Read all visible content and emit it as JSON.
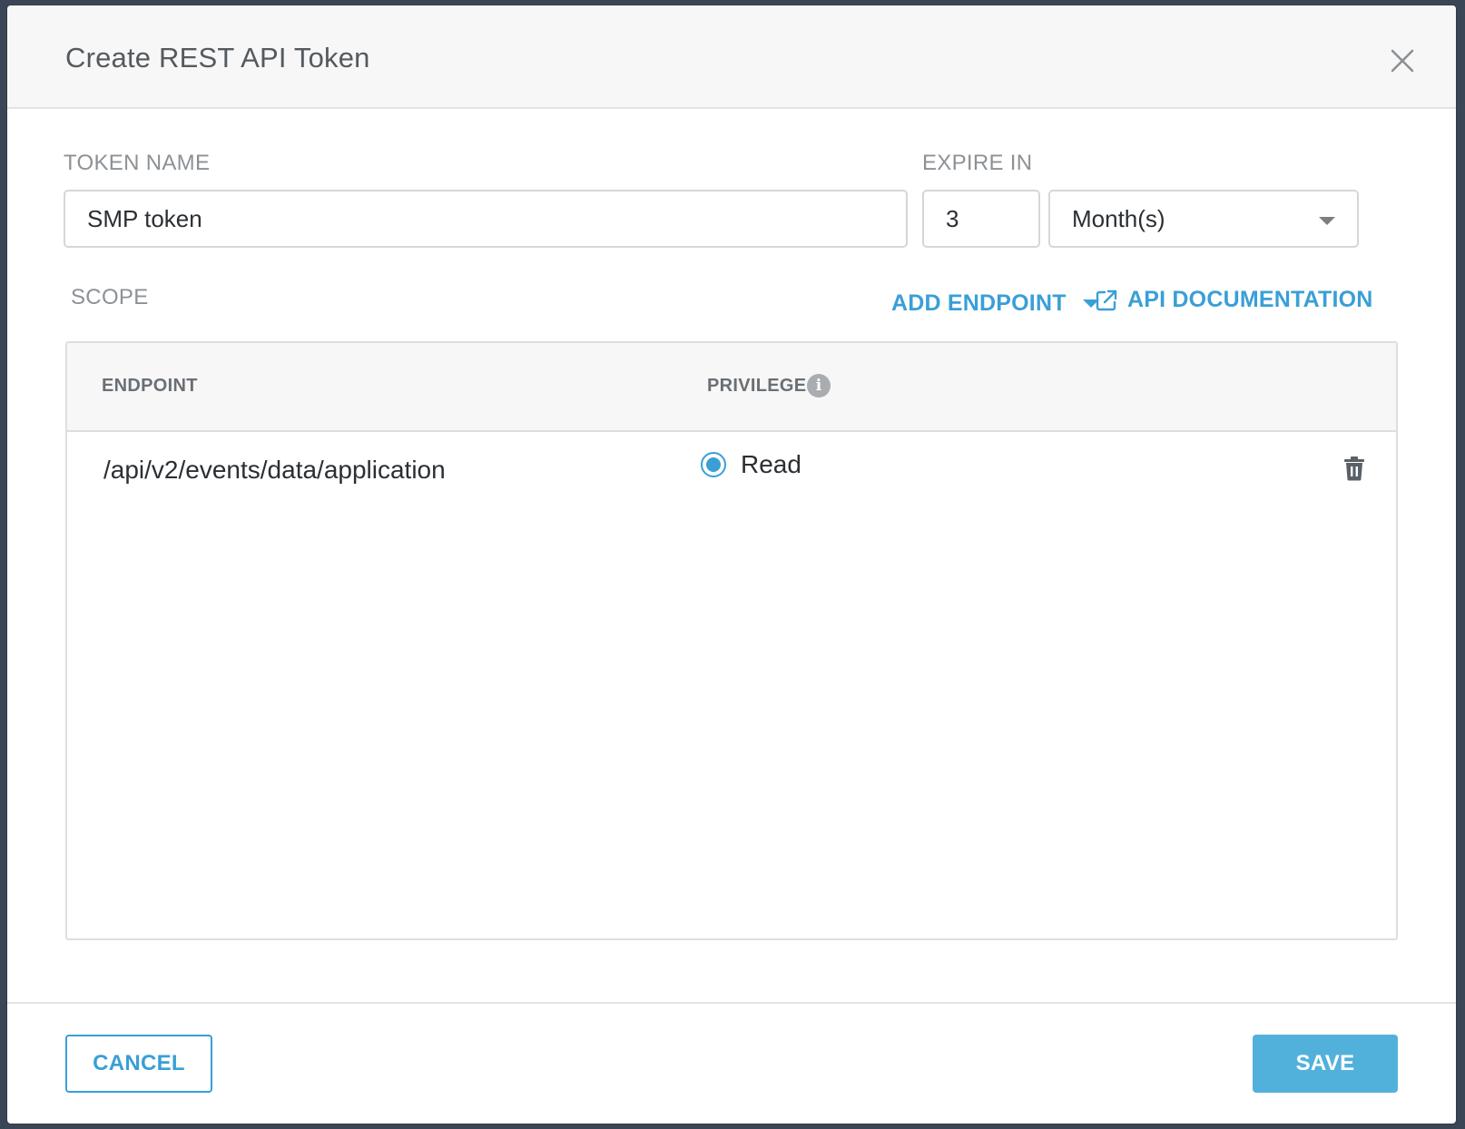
{
  "dialog": {
    "title": "Create REST API Token",
    "close_icon": "close-icon"
  },
  "form": {
    "token_name_label": "TOKEN NAME",
    "token_name_value": "SMP token",
    "expire_label": "EXPIRE IN",
    "expire_value": "3",
    "expire_unit": "Month(s)"
  },
  "scope": {
    "label": "SCOPE",
    "add_endpoint_label": "ADD ENDPOINT",
    "api_docs_label": "API DOCUMENTATION",
    "api_docs_icon": "external-link-icon",
    "columns": [
      "ENDPOINT",
      "PRIVILEGE"
    ],
    "privilege_info_icon": "info-icon",
    "rows": [
      {
        "endpoint": "/api/v2/events/data/application",
        "privilege": "Read",
        "selected": true,
        "delete_icon": "trash-icon"
      }
    ]
  },
  "footer": {
    "cancel_label": "CANCEL",
    "save_label": "SAVE"
  },
  "colors": {
    "accent": "#3a9fd6",
    "save_bg": "#52b1db",
    "overlay": "#3a4656"
  }
}
